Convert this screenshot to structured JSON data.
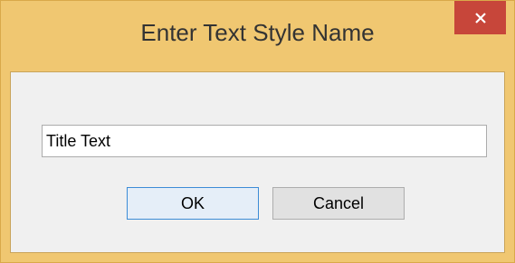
{
  "dialog": {
    "title": "Enter Text Style Name",
    "close_symbol": "×",
    "input_value": "Title Text",
    "ok_label": "OK",
    "cancel_label": "Cancel"
  },
  "colors": {
    "frame": "#f0c771",
    "close_button": "#c7463a",
    "client_bg": "#f0f0f0",
    "default_button_border": "#3c8cd6"
  }
}
